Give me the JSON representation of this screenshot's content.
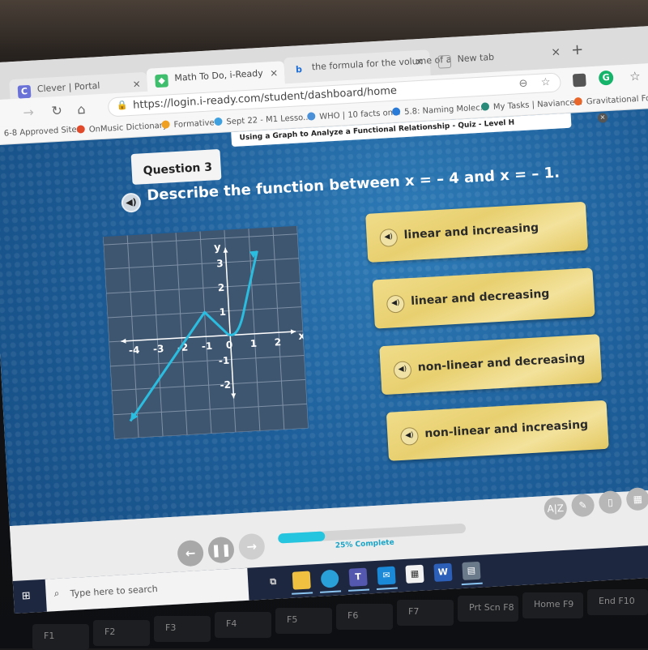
{
  "browser": {
    "tabs": [
      {
        "label": "Clever | Portal",
        "icon": "clever-icon",
        "color": "#6a72d8"
      },
      {
        "label": "Math To Do, i-Ready",
        "icon": "iready-icon",
        "color": "#3fbf6e",
        "active": true
      },
      {
        "label": "the formula for the volume of a",
        "icon": "bing-icon",
        "color": "#1f6fd6"
      },
      {
        "label": "New tab",
        "icon": "newtab-icon",
        "color": "#888888"
      }
    ],
    "close_tab": "×",
    "new_tab": "+",
    "url": "https://login.i-ready.com/student/dashboard/home",
    "bookmarks": [
      {
        "label": "6-8 Approved Sites",
        "color": "#999999"
      },
      {
        "label": "OnMusic Dictionary",
        "color": "#e04a2a"
      },
      {
        "label": "Formative",
        "color": "#f0a020"
      },
      {
        "label": "Sept 22 - M1 Lesso...",
        "color": "#3fa0e0"
      },
      {
        "label": "WHO | 10 facts on...",
        "color": "#4a90d9"
      },
      {
        "label": "5.8: Naming Molec...",
        "color": "#2a7ad8"
      },
      {
        "label": "My Tasks | Naviance...",
        "color": "#2a8a7a"
      },
      {
        "label": "Gravitational Forces...",
        "color": "#e8662a"
      }
    ]
  },
  "quiz": {
    "title": "Using a Graph to Analyze a Functional Relationship - Quiz - Level H",
    "question_number": "Question 3",
    "question_text": "Describe the function between x = – 4 and x = – 1.",
    "answers": [
      {
        "label": "linear and increasing"
      },
      {
        "label": "linear and decreasing"
      },
      {
        "label": "non-linear and decreasing"
      },
      {
        "label": "non-linear and increasing"
      }
    ],
    "progress_percent": 25,
    "progress_text": "25% Complete",
    "tools": [
      "glossary-icon",
      "pencil-icon",
      "notepad-icon",
      "calculator-icon"
    ],
    "tool_glyphs": [
      "A|Z",
      "✎",
      "▯",
      "▦"
    ]
  },
  "graph": {
    "x_label": "x",
    "y_label": "y",
    "x_ticks": [
      "-4",
      "-3",
      "-2",
      "-1",
      "0",
      "1",
      "2"
    ],
    "y_ticks": [
      "3",
      "2",
      "1",
      "-1",
      "-2"
    ],
    "line_color": "#2bbde0"
  },
  "taskbar": {
    "search_placeholder": "Type here to search",
    "apps": [
      "task-view-icon",
      "file-explorer-icon",
      "edge-icon",
      "teams-icon",
      "mail-icon",
      "store-icon",
      "word-icon",
      "calculator-app-icon"
    ]
  },
  "keyboard": {
    "keys": [
      "F1",
      "F2",
      "F3",
      "F4",
      "F5",
      "F6",
      "F7",
      "Prt Scn F8",
      "Home F9",
      "End F10"
    ]
  }
}
